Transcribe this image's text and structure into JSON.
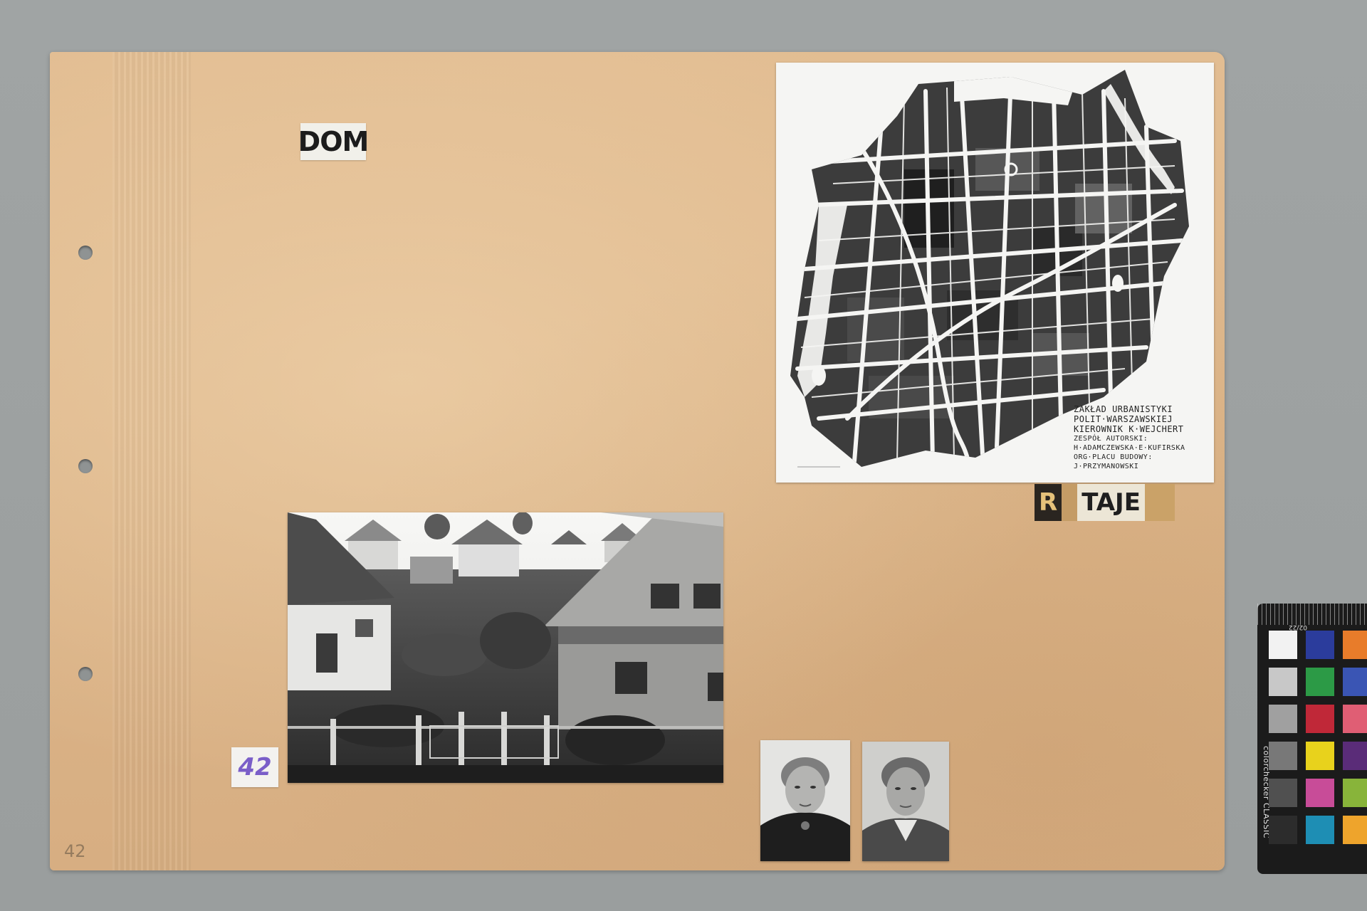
{
  "album_page": {
    "background_color": "#ddb68a",
    "label": "DOM",
    "page_number_sticker": "42",
    "pencil_page_number": "42"
  },
  "map": {
    "caption": {
      "line1": "ZAKŁAD URBANISTYKI",
      "line2": "POLIT·WARSZAWSKIEJ",
      "line3": "KIEROWNIK K·WEJCHERT",
      "line4": "ZESPÓŁ AUTORSKI:",
      "line5": "H·ADAMCZEWSKA·E·KUFIRSKA",
      "line6": "ORG·PLACU BUDOWY:",
      "line7": "J·PRZYMANOWSKI"
    }
  },
  "cutout_letters": {
    "first": "R",
    "rest": "TAJE"
  },
  "color_checker": {
    "ruler_label": "02/22",
    "brand": "colorchecker CLASSIC",
    "swatches": [
      "#f2f2f2",
      "#2b3c9c",
      "#e87c2a",
      "#c8c8c8",
      "#2c9a46",
      "#3a55b4",
      "#a0a0a0",
      "#c02838",
      "#e05e74",
      "#787878",
      "#e8d21c",
      "#5a2c78",
      "#505050",
      "#c84c98",
      "#88b43a",
      "#2c2c2c",
      "#1e8eb4",
      "#eea42c"
    ]
  }
}
